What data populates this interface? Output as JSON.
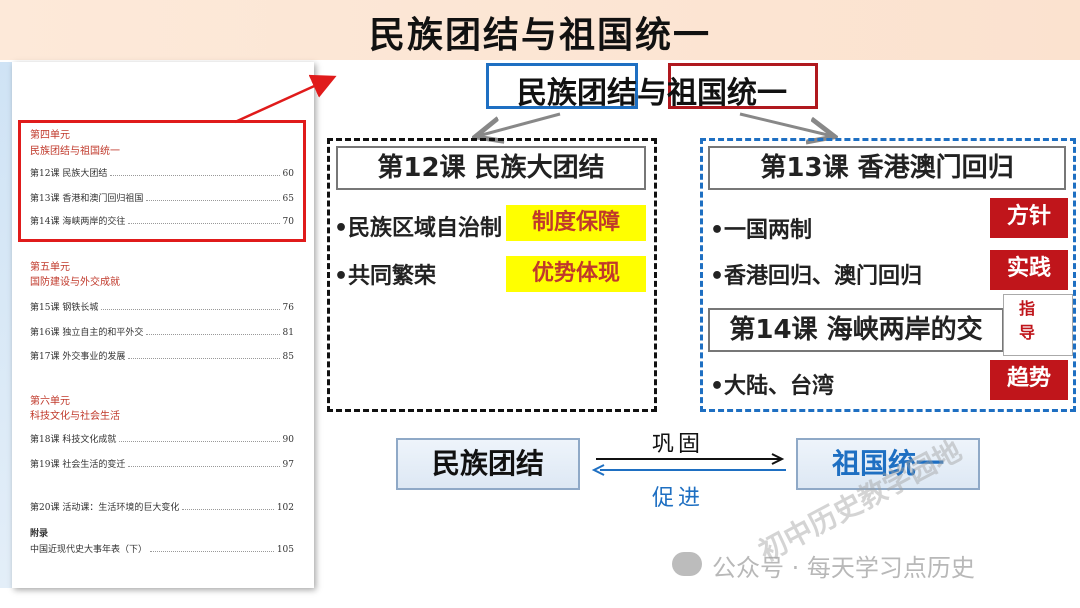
{
  "banner": {
    "title": "民族团结与祖国统一"
  },
  "toc": {
    "units": [
      {
        "head": "第四单元",
        "sub": "民族团结与祖国统一",
        "lessons": [
          {
            "label": "第12课  民族大团结",
            "page": "60"
          },
          {
            "label": "第13课  香港和澳门回归祖国",
            "page": "65"
          },
          {
            "label": "第14课  海峡两岸的交往",
            "page": "70"
          }
        ]
      },
      {
        "head": "第五单元",
        "sub": "国防建设与外交成就",
        "lessons": [
          {
            "label": "第15课  钢铁长城",
            "page": "76"
          },
          {
            "label": "第16课  独立自主的和平外交",
            "page": "81"
          },
          {
            "label": "第17课  外交事业的发展",
            "page": "85"
          }
        ]
      },
      {
        "head": "第六单元",
        "sub": "科技文化与社会生活",
        "lessons": [
          {
            "label": "第18课  科技文化成就",
            "page": "90"
          },
          {
            "label": "第19课  社会生活的变迁",
            "page": "97"
          }
        ]
      }
    ],
    "activity": {
      "label": "第20课  活动课：生活环境的巨大变化",
      "page": "102"
    },
    "appendix": {
      "head": "附录",
      "label": "中国近现代史大事年表（下）",
      "page": "105"
    }
  },
  "header": {
    "part1": "民族团结",
    "part2": "与",
    "part3": "祖国统一"
  },
  "left_panel": {
    "lesson_title": "第12课  民族大团结",
    "bullet1": "•民族区域自治制",
    "bullet2": "•共同繁荣",
    "tag1": "制度保障",
    "tag2": "优势体现"
  },
  "right_panel": {
    "lesson13_title": "第13课  香港澳门回归",
    "bullet1": "•一国两制",
    "bullet2": "•香港回归、澳门回归",
    "lesson14_title": "第14课  海峡两岸的交",
    "bullet3": "•大陆、台湾",
    "tag1": "方针",
    "tag2": "实践",
    "tag3": "趋势",
    "guide1": "指",
    "guide2": "导"
  },
  "relation": {
    "left": "民族团结",
    "right": "祖国统一",
    "top_label": "巩固",
    "bottom_label": "促进"
  },
  "watermark": {
    "account": "公众号 · 每天学习点历史",
    "diagonal": "初中历史教学园地"
  },
  "colors": {
    "red": "#c0151b",
    "blue": "#1e6fc2",
    "yellow": "#ffff00",
    "banner_bg": "#fde9d9"
  }
}
